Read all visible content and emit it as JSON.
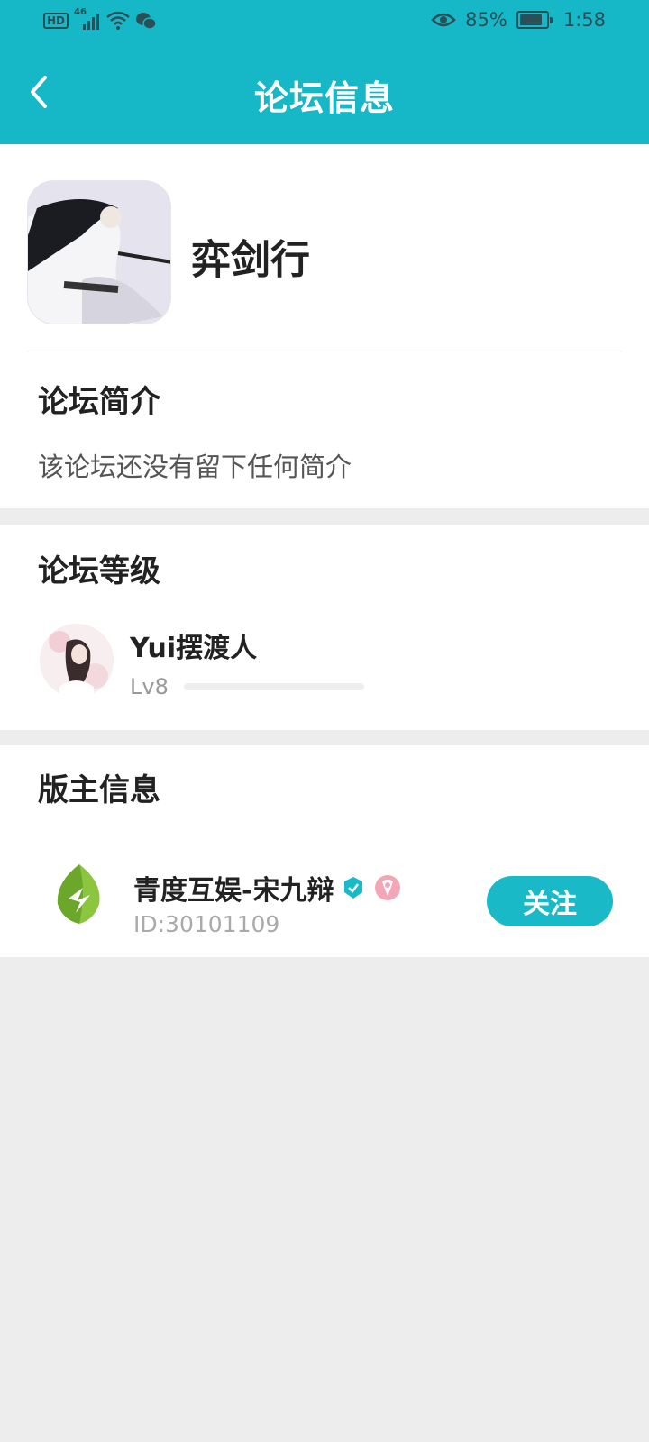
{
  "status_bar": {
    "hd": "HD",
    "network": "46",
    "battery_pct": "85%",
    "battery_level": 0.85,
    "time": "1:58",
    "icons": [
      "hd-icon",
      "signal-icon",
      "wifi-icon",
      "wechat-icon",
      "eye-icon",
      "battery-icon"
    ]
  },
  "header": {
    "title": "论坛信息",
    "back_icon": "chevron-left-icon"
  },
  "forum": {
    "name": "弈剑行",
    "intro_title": "论坛简介",
    "intro_text": "该论坛还没有留下任何简介"
  },
  "level": {
    "title": "论坛等级",
    "user_name": "Yui摆渡人",
    "level_label": "Lv8",
    "progress": 0.0
  },
  "moderator": {
    "title": "版主信息",
    "name": "青度互娱-宋九辩",
    "id_text": "ID:30101109",
    "follow_label": "关注",
    "badges": [
      "verified-badge-icon",
      "pink-badge-icon"
    ]
  },
  "colors": {
    "header_bg": "#16b7c6",
    "accent": "#1ab9c8",
    "page_bg": "#ededed"
  }
}
